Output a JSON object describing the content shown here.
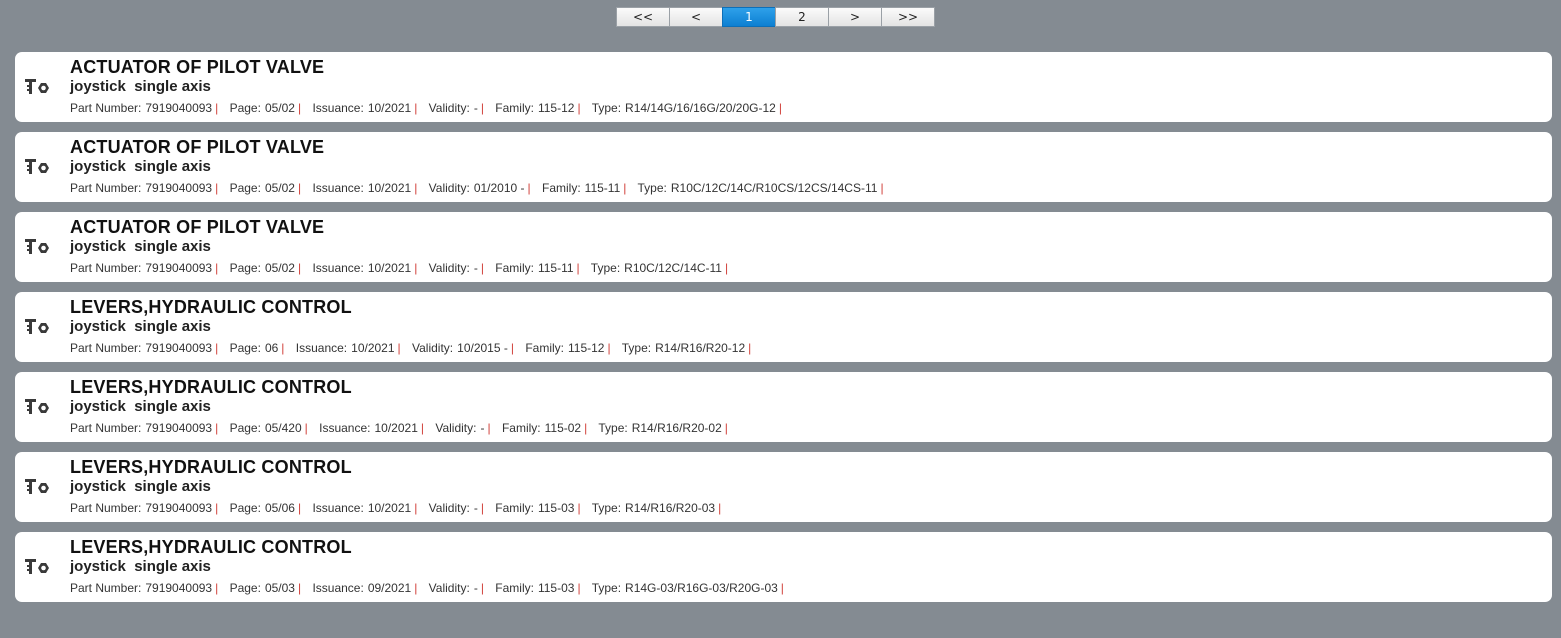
{
  "pagination": {
    "buttons": [
      {
        "label": "<<",
        "name": "first-page-button",
        "active": false
      },
      {
        "label": "<",
        "name": "prev-page-button",
        "active": false
      },
      {
        "label": "1",
        "name": "page-1-button",
        "active": true
      },
      {
        "label": "2",
        "name": "page-2-button",
        "active": false
      },
      {
        "label": ">",
        "name": "next-page-button",
        "active": false
      },
      {
        "label": ">>",
        "name": "last-page-button",
        "active": false
      }
    ]
  },
  "labels": {
    "part_number": "Part Number:",
    "page": "Page:",
    "issuance": "Issuance:",
    "validity": "Validity:",
    "family": "Family:",
    "type": "Type:",
    "separator": "|"
  },
  "items": [
    {
      "icon": "parts-tool-icon",
      "title": "ACTUATOR OF PILOT VALVE",
      "subtitle": "joystick  single axis",
      "part_number": "7919040093",
      "page": "05/02",
      "issuance": "10/2021",
      "validity": "-",
      "family": "115-12",
      "type": "R14/14G/16/16G/20/20G-12"
    },
    {
      "icon": "parts-tool-icon",
      "title": "ACTUATOR OF PILOT VALVE",
      "subtitle": "joystick  single axis",
      "part_number": "7919040093",
      "page": "05/02",
      "issuance": "10/2021",
      "validity": "01/2010 -",
      "family": "115-11",
      "type": "R10C/12C/14C/R10CS/12CS/14CS-11"
    },
    {
      "icon": "parts-tool-icon",
      "title": "ACTUATOR OF PILOT VALVE",
      "subtitle": "joystick  single axis",
      "part_number": "7919040093",
      "page": "05/02",
      "issuance": "10/2021",
      "validity": "-",
      "family": "115-11",
      "type": "R10C/12C/14C-11"
    },
    {
      "icon": "parts-tool-icon",
      "title": "LEVERS,HYDRAULIC CONTROL",
      "subtitle": "joystick  single axis",
      "part_number": "7919040093",
      "page": "06",
      "issuance": "10/2021",
      "validity": "10/2015 -",
      "family": "115-12",
      "type": "R14/R16/R20-12"
    },
    {
      "icon": "parts-tool-icon",
      "title": "LEVERS,HYDRAULIC CONTROL",
      "subtitle": "joystick  single axis",
      "part_number": "7919040093",
      "page": "05/420",
      "issuance": "10/2021",
      "validity": "-",
      "family": "115-02",
      "type": "R14/R16/R20-02"
    },
    {
      "icon": "parts-tool-icon",
      "title": "LEVERS,HYDRAULIC CONTROL",
      "subtitle": "joystick  single axis",
      "part_number": "7919040093",
      "page": "05/06",
      "issuance": "10/2021",
      "validity": "-",
      "family": "115-03",
      "type": "R14/R16/R20-03"
    },
    {
      "icon": "parts-tool-icon",
      "title": "LEVERS,HYDRAULIC CONTROL",
      "subtitle": "joystick  single axis",
      "part_number": "7919040093",
      "page": "05/03",
      "issuance": "09/2021",
      "validity": "-",
      "family": "115-03",
      "type": "R14G-03/R16G-03/R20G-03"
    }
  ]
}
